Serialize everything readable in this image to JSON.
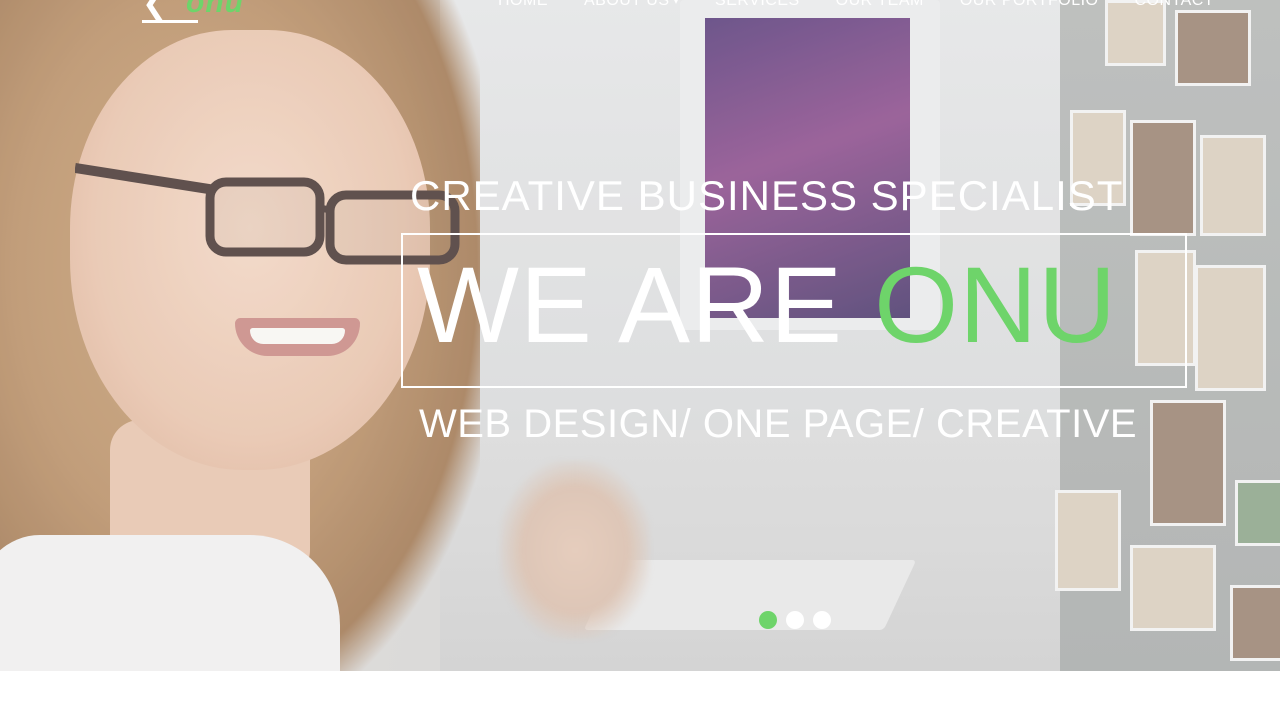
{
  "colors": {
    "accent": "#6ed46a",
    "text": "#ffffff"
  },
  "logo": {
    "mark": "❮",
    "text": "onu"
  },
  "nav": {
    "items": [
      {
        "label": "HOME"
      },
      {
        "label": "ABOUT US",
        "has_dropdown": true,
        "caret": "▾"
      },
      {
        "label": "SERVICES"
      },
      {
        "label": "OUR TEAM"
      },
      {
        "label": "OUR PORTFOLIO"
      },
      {
        "label": "CONTACT"
      }
    ]
  },
  "hero": {
    "subtitle": "CREATIVE BUSINESS SPECIALIST",
    "headline_prefix": "WE ARE ",
    "headline_accent": "ONU",
    "tagline": "WEB DESIGN/ ONE PAGE/ CREATIVE"
  },
  "slider": {
    "slides": 3,
    "active_index": 0
  }
}
